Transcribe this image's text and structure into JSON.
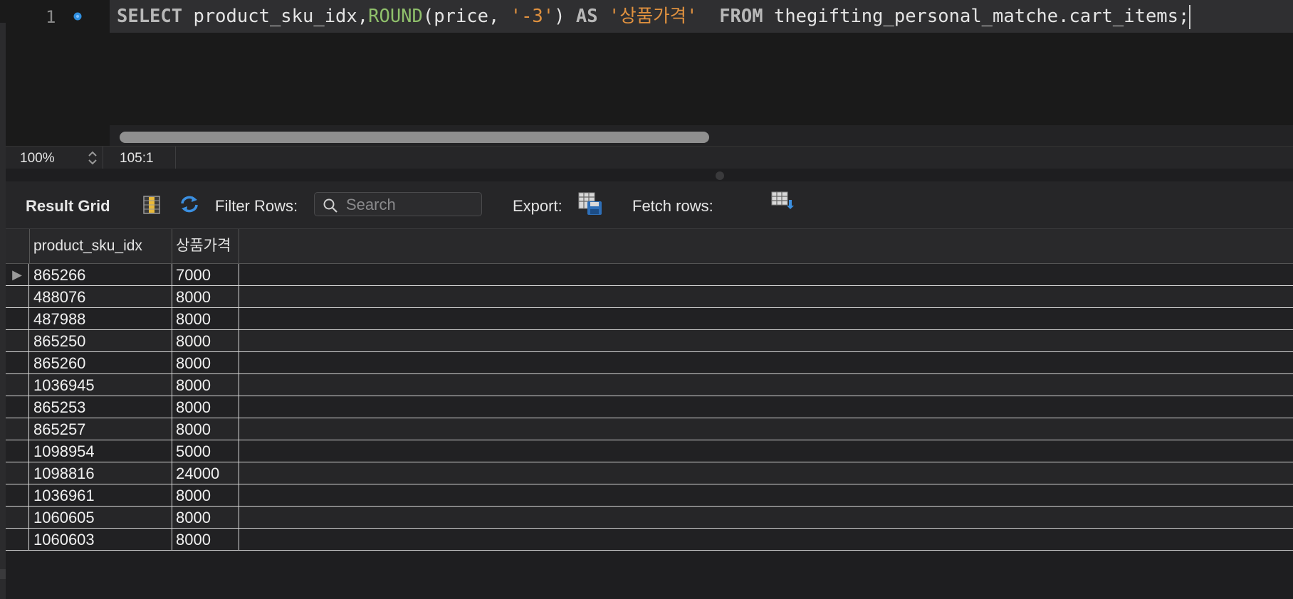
{
  "editor": {
    "line_number": "1",
    "tokens": {
      "t1": "SELECT",
      "t2": " product_sku_idx,",
      "t3": "ROUND",
      "t4": "(price, ",
      "t5": "'-3'",
      "t6": ") ",
      "t7": "AS",
      "t8": " ",
      "t9": "'상품가격'",
      "t10": "  ",
      "t11": "FROM",
      "t12": " thegifting_personal_matche.cart_items;"
    }
  },
  "status": {
    "zoom": "100%",
    "cursor_position": "105:1"
  },
  "toolbar": {
    "result_grid_label": "Result Grid",
    "filter_rows_label": "Filter Rows:",
    "search_placeholder": "Search",
    "export_label": "Export:",
    "fetch_rows_label": "Fetch rows:"
  },
  "grid": {
    "columns": [
      "product_sku_idx",
      "상품가격"
    ],
    "rows": [
      [
        "865266",
        "7000"
      ],
      [
        "488076",
        "8000"
      ],
      [
        "487988",
        "8000"
      ],
      [
        "865250",
        "8000"
      ],
      [
        "865260",
        "8000"
      ],
      [
        "1036945",
        "8000"
      ],
      [
        "865253",
        "8000"
      ],
      [
        "865257",
        "8000"
      ],
      [
        "1098954",
        "5000"
      ],
      [
        "1098816",
        "24000"
      ],
      [
        "1036961",
        "8000"
      ],
      [
        "1060605",
        "8000"
      ],
      [
        "1060603",
        "8000"
      ]
    ],
    "current_row_marker": "▶"
  },
  "colors": {
    "keyword": "#b8b8b8",
    "function": "#8fbf6b",
    "string": "#e0913f",
    "accent": "#2f8fe0"
  }
}
